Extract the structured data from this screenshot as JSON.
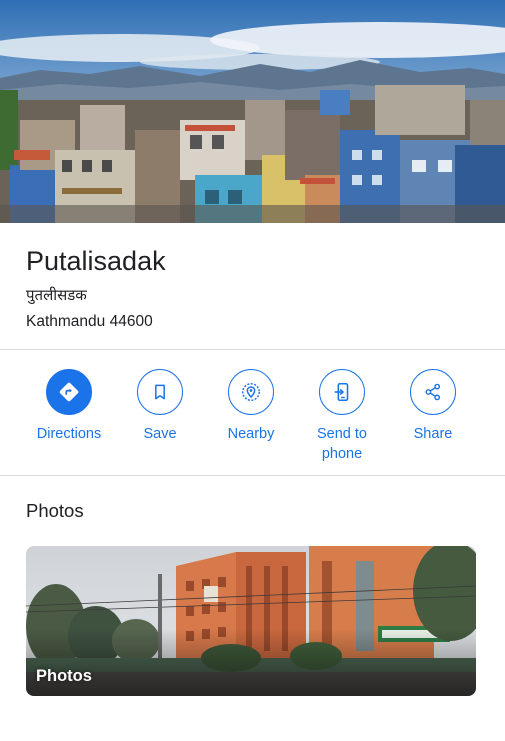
{
  "place": {
    "name": "Putalisadak",
    "native_name": "पुतलीसडक",
    "address": "Kathmandu 44600"
  },
  "actions": [
    {
      "label": "Directions",
      "icon": "directions-icon"
    },
    {
      "label": "Save",
      "icon": "bookmark-icon"
    },
    {
      "label": "Nearby",
      "icon": "nearby-icon"
    },
    {
      "label": "Send to phone",
      "icon": "send-to-phone-icon"
    },
    {
      "label": "Share",
      "icon": "share-icon"
    }
  ],
  "photos": {
    "heading": "Photos",
    "card_caption": "Photos"
  },
  "colors": {
    "accent": "#1a73e8",
    "divider": "#dadce0",
    "text": "#202124"
  }
}
